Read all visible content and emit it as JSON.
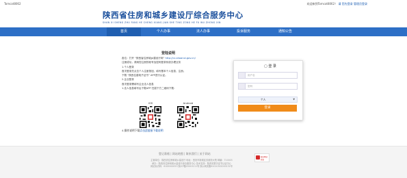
{
  "topbar": {
    "site_code": "Tomcat8062",
    "welcome": "欢迎来到Tomcat8062！",
    "links": [
      "请 您先登录",
      "管理员登录"
    ]
  },
  "header": {
    "title": "陕西省住房和城乡建设厅综合服务中心",
    "subtitle": "SHAN XI SHENG ZHU FANG HE CHENG XIANG JIAN SHE TING ZONG HE FU WU ZHONG XIN"
  },
  "nav": {
    "items": [
      "首页",
      "个人办事",
      "法人办事",
      "投诉服务",
      "通知公告"
    ],
    "active_index": 0
  },
  "guide": {
    "title": "登陆说明",
    "lines": [
      "各位：打开 “陕西省住房城乡建设厅网” ",
      "注册成功，请用您注册的帐号及密码登录系统办理业务",
      "1.个人登录",
      "首次登录先点击个人注册按钮，填写基本个人信息，注册。",
      "下载 “陕西住建电子证书” APP进行认证。",
      "2.企业登录",
      "首次登录需填写企业法人信息",
      "1.法人信息填写后下载APP 扫描下方二维码下载："
    ],
    "link_text": "http://cx.shaanxi.gov.cn/",
    "qr_labels": [
      "IOS",
      "Android"
    ],
    "footer_text": "4.操作说明下载",
    "footer_link": "点击此链接下载说明"
  },
  "login": {
    "title": "登 录",
    "username_placeholder": "用户名",
    "password_placeholder": "密码",
    "user_type": "个人",
    "user_type_arrow": "▼",
    "submit_label": "登录"
  },
  "footer": {
    "links": "登记表格 | 网站地图 | 联系我们 | 关于网站",
    "info_lines": [
      "主管单位：陕西省住房和城乡建设厅  地址：西安市新城区省政府大院  邮编：710003",
      "承办：陕西省住房和城乡建设厅综合服务中心  技术支持：陕西省数字证书认证中心",
      "网站标识码：6100000053  陕ICP备05003211号  陕公网安备61010302000131号"
    ],
    "badge_line1": "政府网站",
    "badge_line2": "找错"
  },
  "colors": {
    "brand_blue": "#2d6fc6",
    "title_blue": "#1a4f9c",
    "login_orange": "#f08b1a"
  }
}
